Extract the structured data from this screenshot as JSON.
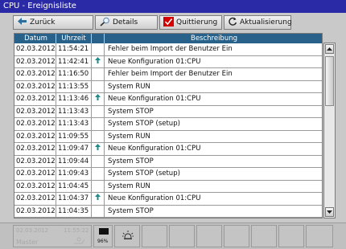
{
  "window": {
    "title": "CPU - Ereignisliste"
  },
  "toolbar": {
    "back_label": "Zurück",
    "details_label": "Details",
    "ack_label": "Quittierung",
    "refresh_label": "Aktualisierung",
    "ack_color": "#d40000"
  },
  "table": {
    "columns": {
      "date": "Datum",
      "time": "Uhrzeit",
      "icon": "",
      "desc": "Beschreibung"
    },
    "rows": [
      {
        "date": "02.03.2012",
        "time": "11:54:21",
        "icon": "",
        "desc": "Fehler beim Import der Benutzer Ein"
      },
      {
        "date": "02.03.2012",
        "time": "11:42:41",
        "icon": "arrow-up-icon",
        "desc": "Neue Konfiguration 01:CPU"
      },
      {
        "date": "02.03.2012",
        "time": "11:16:50",
        "icon": "",
        "desc": "Fehler beim Import der Benutzer Ein"
      },
      {
        "date": "02.03.2012",
        "time": "11:13:55",
        "icon": "",
        "desc": "System RUN"
      },
      {
        "date": "02.03.2012",
        "time": "11:13:46",
        "icon": "arrow-up-icon",
        "desc": "Neue Konfiguration 01:CPU"
      },
      {
        "date": "02.03.2012",
        "time": "11:13:43",
        "icon": "",
        "desc": "System STOP"
      },
      {
        "date": "02.03.2012",
        "time": "11:13:43",
        "icon": "",
        "desc": "System STOP (setup)"
      },
      {
        "date": "02.03.2012",
        "time": "11:09:55",
        "icon": "",
        "desc": "System RUN"
      },
      {
        "date": "02.03.2012",
        "time": "11:09:47",
        "icon": "arrow-up-icon",
        "desc": "Neue Konfiguration 01:CPU"
      },
      {
        "date": "02.03.2012",
        "time": "11:09:44",
        "icon": "",
        "desc": "System STOP"
      },
      {
        "date": "02.03.2012",
        "time": "11:09:43",
        "icon": "",
        "desc": "System STOP (setup)"
      },
      {
        "date": "02.03.2012",
        "time": "11:04:45",
        "icon": "",
        "desc": "System RUN"
      },
      {
        "date": "02.03.2012",
        "time": "11:04:37",
        "icon": "arrow-up-icon",
        "desc": "Neue Konfiguration 01:CPU"
      },
      {
        "date": "02.03.2012",
        "time": "11:04:35",
        "icon": "",
        "desc": "System STOP"
      }
    ]
  },
  "statusbar": {
    "date": "02.03.2012",
    "time": "11:55:22",
    "user": "Master",
    "battery_level": "96%"
  }
}
